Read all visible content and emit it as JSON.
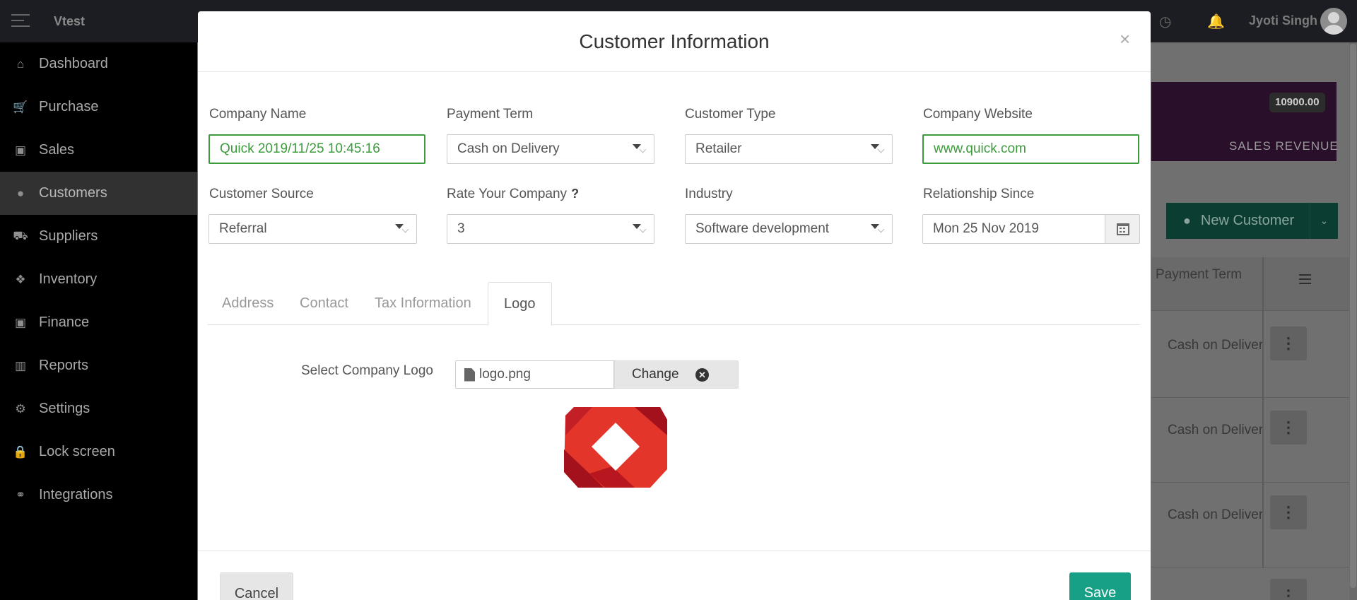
{
  "app": {
    "brand": "Vtest",
    "user_name": "Jyoti Singh"
  },
  "sidebar": {
    "items": [
      {
        "label": "Dashboard",
        "icon": "home-icon",
        "glyph": "⌂"
      },
      {
        "label": "Purchase",
        "icon": "cart-icon",
        "glyph": "🛒"
      },
      {
        "label": "Sales",
        "icon": "money-icon",
        "glyph": "▣"
      },
      {
        "label": "Customers",
        "icon": "user-icon",
        "glyph": "●",
        "active": true
      },
      {
        "label": "Suppliers",
        "icon": "truck-icon",
        "glyph": "⛟"
      },
      {
        "label": "Inventory",
        "icon": "cubes-icon",
        "glyph": "❖"
      },
      {
        "label": "Finance",
        "icon": "money-icon",
        "glyph": "▣"
      },
      {
        "label": "Reports",
        "icon": "bar-chart-icon",
        "glyph": "▥"
      },
      {
        "label": "Settings",
        "icon": "gears-icon",
        "glyph": "⚙"
      },
      {
        "label": "Lock screen",
        "icon": "lock-icon",
        "glyph": "🔒"
      },
      {
        "label": "Integrations",
        "icon": "link-icon",
        "glyph": "⚭"
      }
    ]
  },
  "dashboard": {
    "revenue_value": "10900.00",
    "revenue_label": "SALES REVENUE",
    "new_customer_label": "New Customer"
  },
  "grid": {
    "column_header": "Payment Term",
    "rows": [
      "Cash on Delivery",
      "Cash on Delivery",
      "Cash on Delivery"
    ]
  },
  "modal": {
    "title": "Customer Information",
    "close_glyph": "×",
    "fields": {
      "company_name": {
        "label": "Company Name",
        "value": "Quick 2019/11/25 10:45:16"
      },
      "payment_term": {
        "label": "Payment Term",
        "value": "Cash on Delivery"
      },
      "customer_type": {
        "label": "Customer Type",
        "value": "Retailer"
      },
      "company_website": {
        "label": "Company Website",
        "value": "www.quick.com"
      },
      "customer_source": {
        "label": "Customer Source",
        "value": "Referral"
      },
      "rate_company": {
        "label": "Rate Your Company",
        "value": "3"
      },
      "industry": {
        "label": "Industry",
        "value": "Software development"
      },
      "relationship_since": {
        "label": "Relationship Since",
        "value": "Mon 25 Nov 2019"
      }
    },
    "tabs": [
      {
        "label": "Address"
      },
      {
        "label": "Contact"
      },
      {
        "label": "Tax Information"
      },
      {
        "label": "Logo",
        "active": true
      }
    ],
    "logo": {
      "select_label": "Select Company Logo",
      "file_name": "logo.png",
      "change_label": "Change"
    },
    "footer": {
      "cancel_label": "Cancel",
      "save_label": "Save"
    }
  },
  "colors": {
    "accent": "#17a085",
    "valid": "#3c9b3c",
    "logo_red": "#e3352a",
    "logo_dark_red": "#a3121c"
  }
}
